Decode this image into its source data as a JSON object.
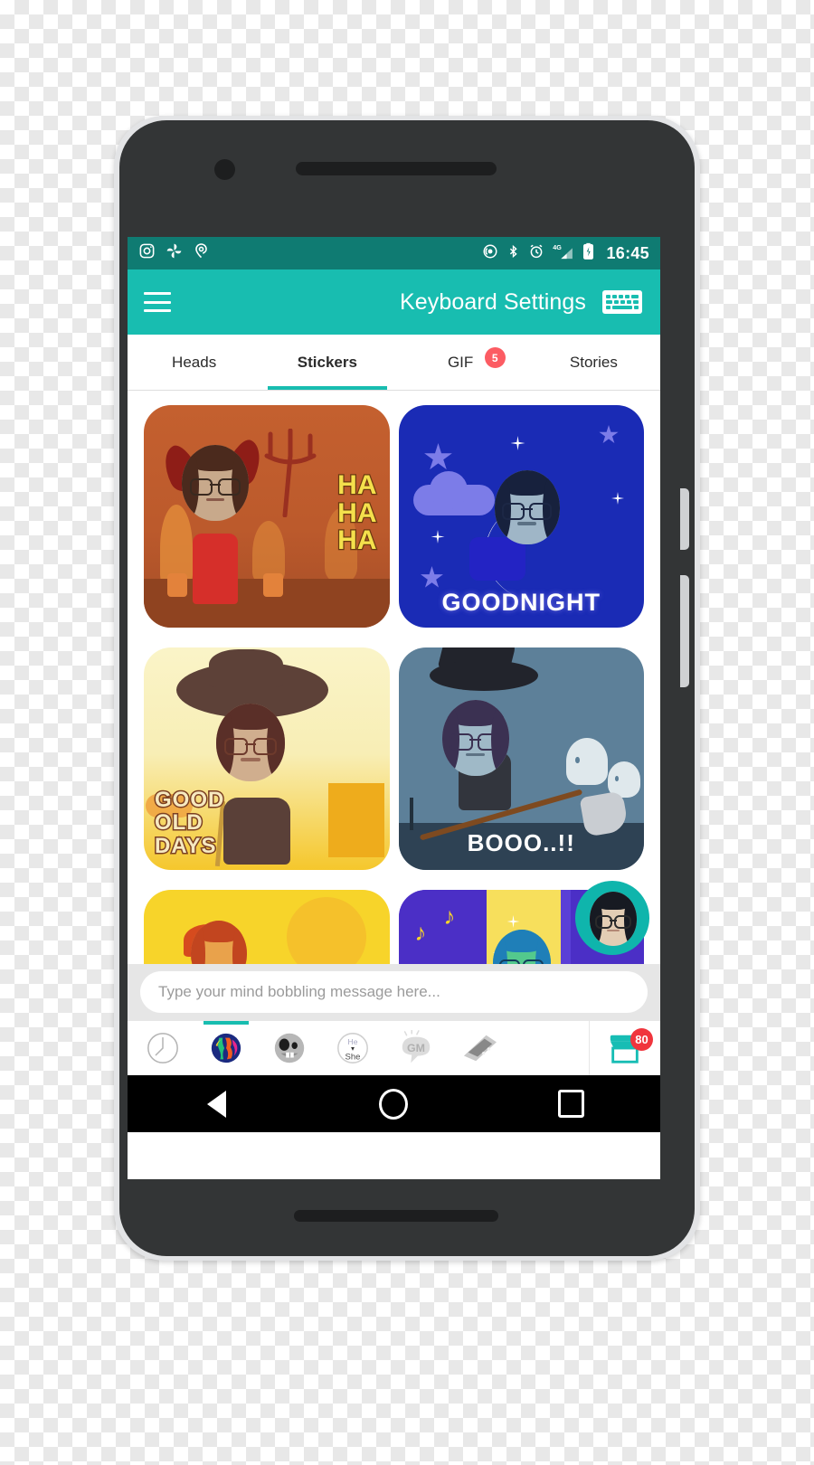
{
  "status_bar": {
    "time": "16:45",
    "left_icons": [
      "instagram-icon",
      "pinwheel-icon",
      "location-pin-icon"
    ],
    "right_icons": [
      "cast-icon",
      "bluetooth-icon",
      "alarm-icon",
      "signal-4g-icon",
      "battery-charging-icon"
    ],
    "network_label": "4G",
    "bg_color": "#0f7b72"
  },
  "app_bar": {
    "title": "Keyboard Settings",
    "menu_icon": "hamburger-menu-icon",
    "keyboard_icon": "keyboard-icon",
    "bg_color": "#18bdb0"
  },
  "tabs": [
    {
      "label": "Heads",
      "active": false,
      "badge": ""
    },
    {
      "label": "Stickers",
      "active": true,
      "badge": ""
    },
    {
      "label": "GIF",
      "active": false,
      "badge": "5"
    },
    {
      "label": "Stories",
      "active": false,
      "badge": ""
    }
  ],
  "stickers": [
    {
      "caption": "HA\nHA\nHA",
      "theme": "devil"
    },
    {
      "caption": "GOODNIGHT",
      "theme": "goodnight"
    },
    {
      "caption": "GOOD\nOLD\nDAYS",
      "theme": "old-days"
    },
    {
      "caption": "BOOO..!!",
      "theme": "witch"
    },
    {
      "caption": "",
      "theme": "sun"
    },
    {
      "caption": "",
      "theme": "stage"
    }
  ],
  "fab": {
    "name": "avatar-head-button"
  },
  "message_input": {
    "placeholder": "Type your mind bobbling message here...",
    "value": ""
  },
  "keyboard_toolbar": {
    "items": [
      {
        "name": "recent-clock-icon",
        "active": false
      },
      {
        "name": "globe-stickers-icon",
        "active": true
      },
      {
        "name": "emoji-face-icon",
        "active": false
      },
      {
        "name": "he-she-icon",
        "label_top": "He",
        "label_bottom": "She",
        "active": false
      },
      {
        "name": "gm-bubble-icon",
        "label": "GM",
        "active": false
      },
      {
        "name": "gif-tape-icon",
        "active": false
      }
    ],
    "store": {
      "name": "store-icon",
      "badge": "80"
    }
  },
  "nav_bar": {
    "back": "back-triangle-icon",
    "home": "home-circle-icon",
    "recents": "recents-square-icon"
  },
  "colors": {
    "accent": "#18bdb0",
    "status_dark": "#0f7b72",
    "badge_red": "#fc5c63",
    "store_badge_red": "#f0353d"
  }
}
